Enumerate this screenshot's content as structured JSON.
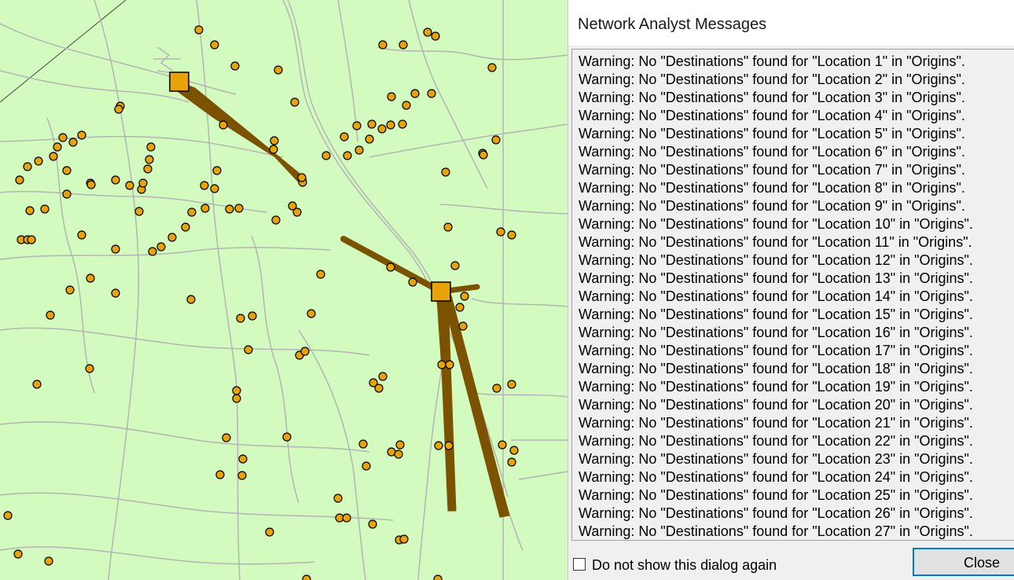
{
  "dialog": {
    "title": "Network Analyst Messages",
    "messages": [
      "Warning: No \"Destinations\" found for \"Location 1\" in \"Origins\".",
      "Warning: No \"Destinations\" found for \"Location 2\" in \"Origins\".",
      "Warning: No \"Destinations\" found for \"Location 3\" in \"Origins\".",
      "Warning: No \"Destinations\" found for \"Location 4\" in \"Origins\".",
      "Warning: No \"Destinations\" found for \"Location 5\" in \"Origins\".",
      "Warning: No \"Destinations\" found for \"Location 6\" in \"Origins\".",
      "Warning: No \"Destinations\" found for \"Location 7\" in \"Origins\".",
      "Warning: No \"Destinations\" found for \"Location 8\" in \"Origins\".",
      "Warning: No \"Destinations\" found for \"Location 9\" in \"Origins\".",
      "Warning: No \"Destinations\" found for \"Location 10\" in \"Origins\".",
      "Warning: No \"Destinations\" found for \"Location 11\" in \"Origins\".",
      "Warning: No \"Destinations\" found for \"Location 12\" in \"Origins\".",
      "Warning: No \"Destinations\" found for \"Location 13\" in \"Origins\".",
      "Warning: No \"Destinations\" found for \"Location 14\" in \"Origins\".",
      "Warning: No \"Destinations\" found for \"Location 15\" in \"Origins\".",
      "Warning: No \"Destinations\" found for \"Location 16\" in \"Origins\".",
      "Warning: No \"Destinations\" found for \"Location 17\" in \"Origins\".",
      "Warning: No \"Destinations\" found for \"Location 18\" in \"Origins\".",
      "Warning: No \"Destinations\" found for \"Location 19\" in \"Origins\".",
      "Warning: No \"Destinations\" found for \"Location 20\" in \"Origins\".",
      "Warning: No \"Destinations\" found for \"Location 21\" in \"Origins\".",
      "Warning: No \"Destinations\" found for \"Location 22\" in \"Origins\".",
      "Warning: No \"Destinations\" found for \"Location 23\" in \"Origins\".",
      "Warning: No \"Destinations\" found for \"Location 24\" in \"Origins\".",
      "Warning: No \"Destinations\" found for \"Location 25\" in \"Origins\".",
      "Warning: No \"Destinations\" found for \"Location 26\" in \"Origins\".",
      "Warning: No \"Destinations\" found for \"Location 27\" in \"Origins\"."
    ],
    "dont_show_label": "Do not show this dialog again",
    "dont_show_checked": false,
    "close_label": "Close"
  },
  "map": {
    "background_color": "#d3fbbf",
    "road_color": "#b4b4b4",
    "point_color": "#e8a20a",
    "facility_color": "#e8a20a",
    "route_color": "#7a5200",
    "icons": {
      "origin_point": "circle",
      "facility": "square"
    }
  }
}
